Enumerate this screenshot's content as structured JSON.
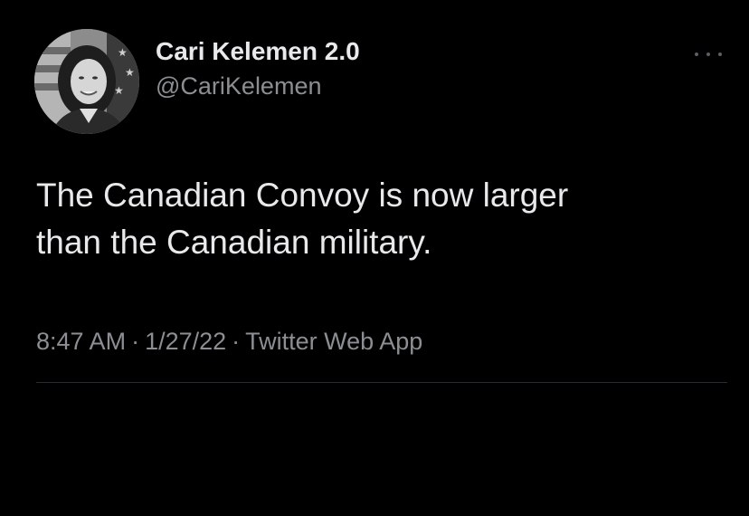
{
  "tweet": {
    "author": {
      "display_name": "Cari Kelemen 2.0",
      "handle": "@CariKelemen",
      "avatar_icon": "profile-photo"
    },
    "text_lines": [
      "The Canadian Convoy is now larger",
      "than the Canadian military."
    ],
    "meta": {
      "time": "8:47 AM",
      "separator": "·",
      "date": "1/27/22",
      "source": "Twitter Web App"
    },
    "more_icon": "more-options-icon"
  },
  "colors": {
    "background": "#000000",
    "primary_text": "#e7e9ea",
    "secondary_text": "#8b8f93",
    "divider": "#2a2d30"
  }
}
